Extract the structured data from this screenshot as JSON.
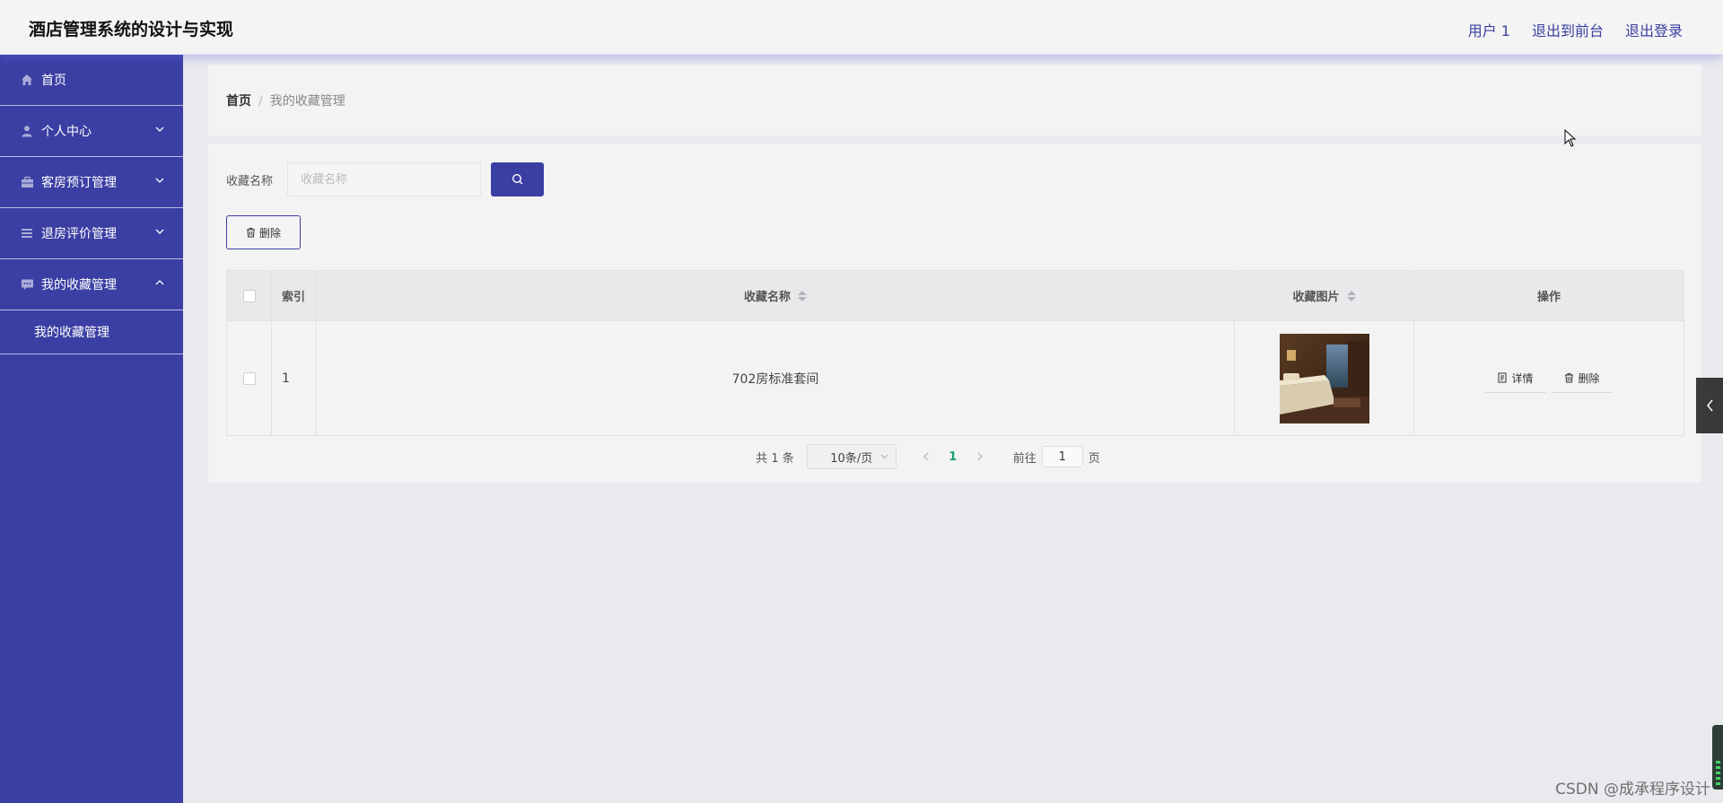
{
  "header": {
    "title": "酒店管理系统的设计与实现",
    "user": "用户 1",
    "back_front": "退出到前台",
    "logout": "退出登录"
  },
  "sidebar": {
    "items": [
      {
        "label": "首页",
        "icon": "home-icon"
      },
      {
        "label": "个人中心",
        "icon": "user-icon",
        "expanded": false
      },
      {
        "label": "客房预订管理",
        "icon": "briefcase-icon",
        "expanded": false
      },
      {
        "label": "退房评价管理",
        "icon": "list-icon",
        "expanded": false
      },
      {
        "label": "我的收藏管理",
        "icon": "chat-icon",
        "expanded": true
      }
    ],
    "submenu": {
      "label": "我的收藏管理"
    }
  },
  "breadcrumb": {
    "home": "首页",
    "separator": "/",
    "current": "我的收藏管理"
  },
  "search": {
    "label": "收藏名称",
    "placeholder": "收藏名称",
    "value": ""
  },
  "toolbar": {
    "delete_label": "删除"
  },
  "table": {
    "columns": [
      "索引",
      "收藏名称",
      "收藏图片",
      "操作"
    ],
    "rows": [
      {
        "index": "1",
        "name": "702房标准套间",
        "detail_label": "详情",
        "delete_label": "删除"
      }
    ]
  },
  "pagination": {
    "total": "共 1 条",
    "page_size": "10条/页",
    "current_page": "1",
    "goto_prefix": "前往",
    "goto_value": "1",
    "goto_suffix": "页"
  },
  "watermark": "CSDN @成承程序设计",
  "colors": {
    "primary": "#3b3fa3",
    "active_page": "#19a26a",
    "header_bg": "#f4f4f4",
    "page_bg": "#e9eaee"
  }
}
